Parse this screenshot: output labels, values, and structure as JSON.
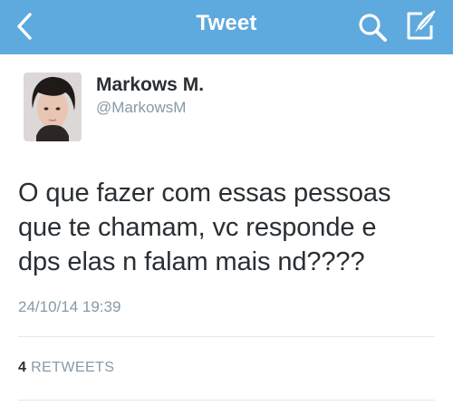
{
  "header": {
    "title": "Tweet",
    "back_icon": "chevron-left-icon",
    "search_icon": "search-icon",
    "compose_icon": "compose-icon",
    "bar_color": "#5ea9dd"
  },
  "author": {
    "name": "Markows M.",
    "handle": "@MarkowsM"
  },
  "tweet": {
    "lines": [
      "O que fazer com essas pessoas",
      "que te chamam, vc responde e",
      "dps elas n falam mais nd????"
    ],
    "timestamp": "24/10/14 19:39"
  },
  "stats": {
    "retweet_count": "4",
    "retweet_label": "RETWEETS"
  }
}
